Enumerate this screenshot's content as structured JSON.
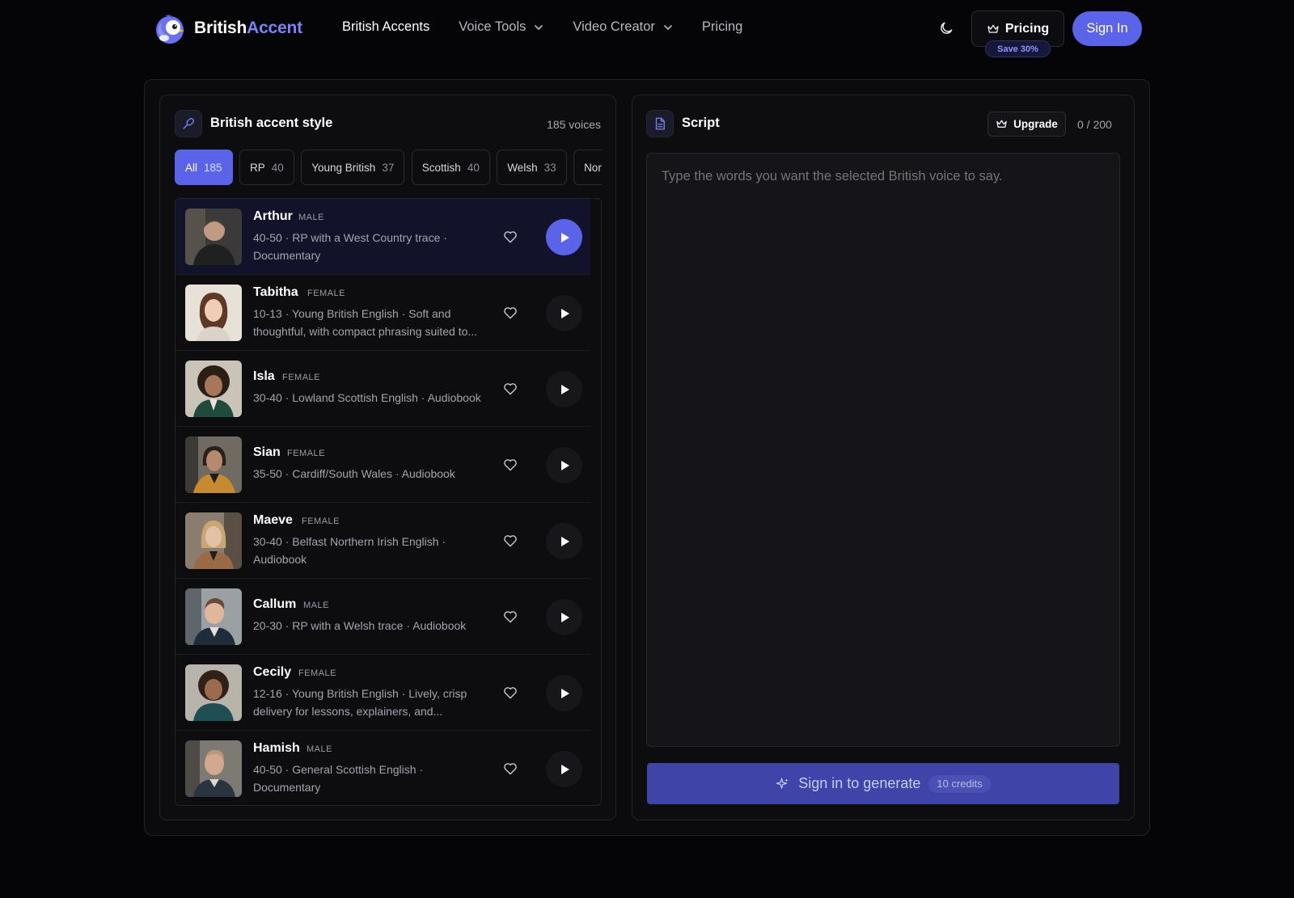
{
  "header": {
    "brand_part1": "British",
    "brand_part2": "Accent",
    "nav": [
      {
        "label": "British Accents"
      },
      {
        "label": "Voice Tools"
      },
      {
        "label": "Video Creator"
      },
      {
        "label": "Pricing"
      }
    ],
    "pricing_button": "Pricing",
    "save_badge": "Save 30%",
    "signin_button": "Sign In"
  },
  "voices_panel": {
    "title": "British accent style",
    "count_label": "185 voices",
    "filters": [
      {
        "label": "All",
        "count": "185",
        "active": true
      },
      {
        "label": "RP",
        "count": "40"
      },
      {
        "label": "Young British",
        "count": "37"
      },
      {
        "label": "Scottish",
        "count": "40"
      },
      {
        "label": "Welsh",
        "count": "33"
      },
      {
        "label": "Nor",
        "count": ""
      }
    ],
    "voices": [
      {
        "name": "Arthur",
        "gender": "MALE",
        "desc_line1": "40-50 · RP with a West Country trace ·",
        "desc_line2": "Documentary",
        "selected": true
      },
      {
        "name": "Tabitha",
        "gender": "FEMALE",
        "desc_line1": "10-13 · Young British English · Soft and",
        "desc_line2": "thoughtful, with compact phrasing suited to..."
      },
      {
        "name": "Isla",
        "gender": "FEMALE",
        "desc_line1": "30-40 · Lowland Scottish English · Audiobook",
        "desc_line2": ""
      },
      {
        "name": "Sian",
        "gender": "FEMALE",
        "desc_line1": "35-50 · Cardiff/South Wales · Audiobook",
        "desc_line2": ""
      },
      {
        "name": "Maeve",
        "gender": "FEMALE",
        "desc_line1": "30-40 · Belfast Northern Irish English ·",
        "desc_line2": "Audiobook"
      },
      {
        "name": "Callum",
        "gender": "MALE",
        "desc_line1": "20-30 · RP with a Welsh trace · Audiobook",
        "desc_line2": ""
      },
      {
        "name": "Cecily",
        "gender": "FEMALE",
        "desc_line1": "12-16 · Young British English · Lively, crisp",
        "desc_line2": "delivery for lessons, explainers, and..."
      },
      {
        "name": "Hamish",
        "gender": "MALE",
        "desc_line1": "40-50 · General Scottish English ·",
        "desc_line2": "Documentary"
      }
    ]
  },
  "script_panel": {
    "title": "Script",
    "upgrade_label": "Upgrade",
    "char_count": "0 / 200",
    "placeholder": "Type the words you want the selected British voice to say.",
    "generate_label": "Sign in to generate",
    "credits_label": "10 credits"
  },
  "colors": {
    "accent": "#5b63e8",
    "brand_accent": "#7b83f5",
    "background": "#050507",
    "panel": "#0d0d10"
  },
  "icons": {
    "logo": "bird-logo-icon",
    "theme": "moon-icon",
    "pricing": "crown-icon",
    "voices": "microphone-icon",
    "script": "document-icon",
    "generate": "sparkles-icon",
    "favorite": "heart-icon",
    "play": "play-icon"
  }
}
